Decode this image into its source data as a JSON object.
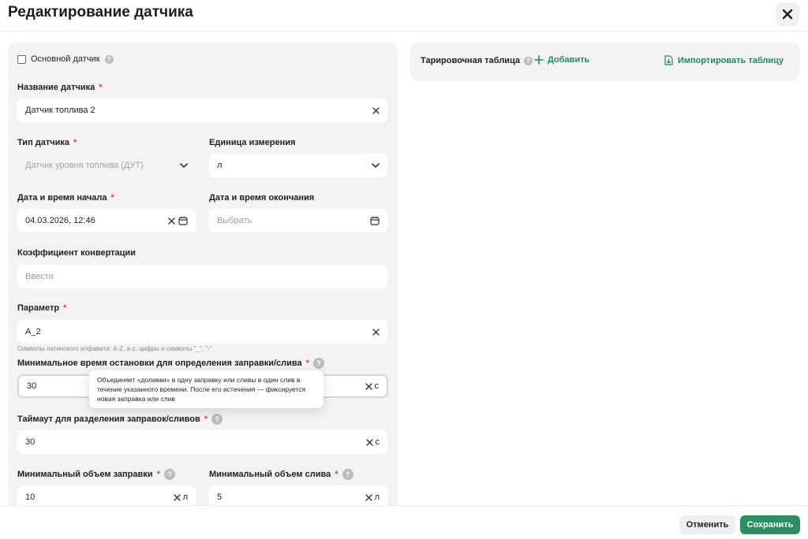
{
  "header": {
    "title": "Редактирование датчика"
  },
  "form": {
    "main_sensor_label": "Основной датчик",
    "name": {
      "label": "Название датчика",
      "value": "Датчик топлива 2"
    },
    "type": {
      "label": "Тип датчика",
      "value": "Датчик уровня топлива (ДУТ)"
    },
    "unit": {
      "label": "Единица измерения",
      "value": "л"
    },
    "start": {
      "label": "Дата и время начала",
      "value": "04.03.2026, 12:46"
    },
    "end": {
      "label": "Дата и время окончания",
      "placeholder": "Выбрать"
    },
    "coef": {
      "label": "Коэффициент конвертации",
      "placeholder": "Ввести"
    },
    "param": {
      "label": "Параметр",
      "value": "A_2",
      "hint": "Символы латинского алфавита: A-Z, a-z, цифры и символы \"_\", \"-\""
    },
    "min_stop": {
      "label": "Минимальное время остановки для определения заправки/слива",
      "value": "30",
      "unit": "с"
    },
    "timeout": {
      "label": "Таймаут для разделения заправок/сливов",
      "value": "30",
      "unit": "с"
    },
    "min_refuel": {
      "label": "Минимальный объем заправки",
      "value": "10",
      "unit": "л"
    },
    "min_drain": {
      "label": "Минимальный объем слива",
      "value": "5",
      "unit": "л"
    },
    "required_mark": "*",
    "help_mark": "?"
  },
  "tooltip": {
    "text": "Объединяет «доливки» в одну заправку или сливы в один слив в течение указанного времени. После его истечения — фиксируется новая заправка или слив"
  },
  "calibration": {
    "title": "Тарировочная таблица",
    "add_label": "Добавить",
    "import_label": "Импортировать таблицу"
  },
  "footer": {
    "cancel_label": "Отменить",
    "save_label": "Сохранить"
  },
  "colors": {
    "accent": "#2a8f63",
    "required": "#e0443a",
    "panel": "#f3f3f3"
  }
}
